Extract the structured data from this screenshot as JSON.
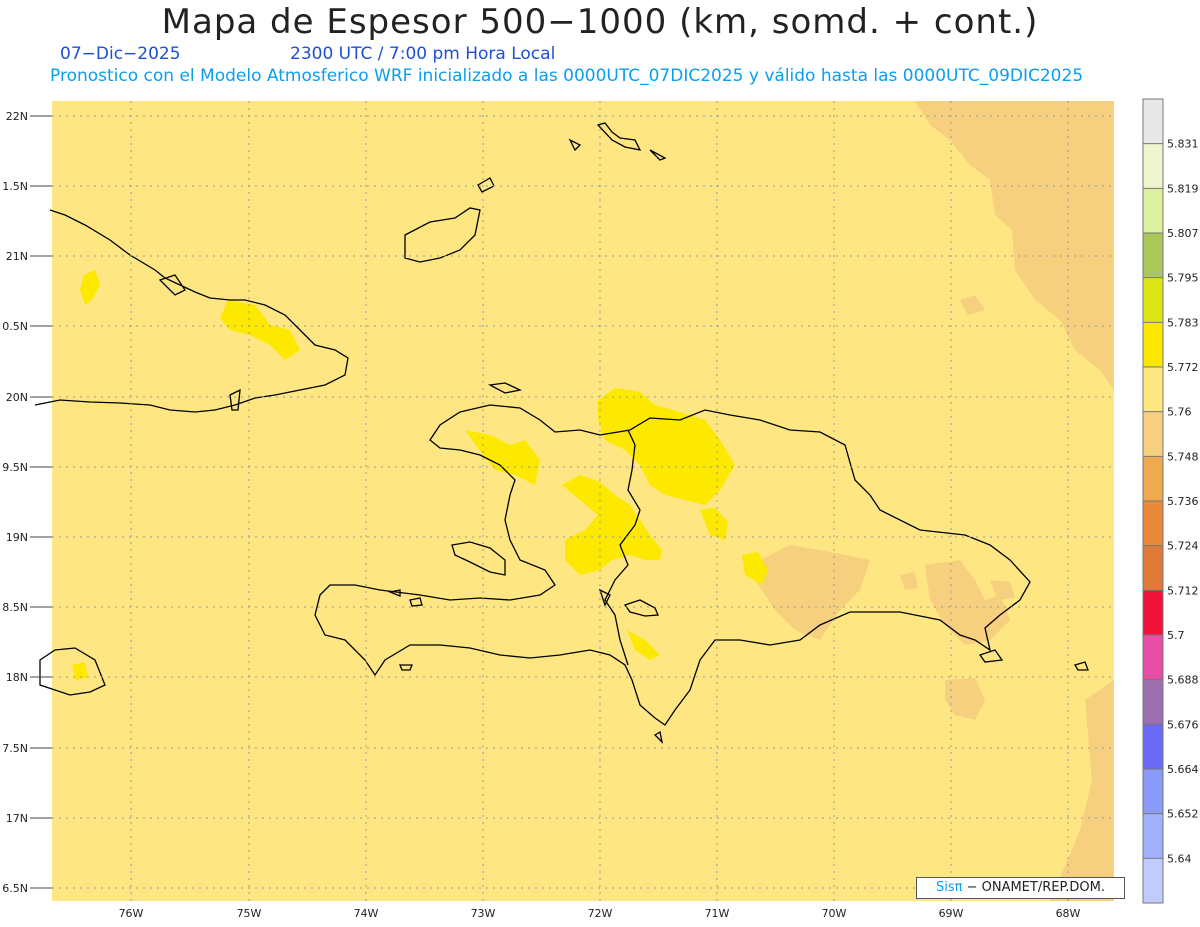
{
  "header": {
    "title": "Mapa de Espesor 500−1000 (km, somd. + cont.)",
    "date": "07−Dic−2025",
    "time": "2300 UTC / 7:00 pm Hora Local",
    "model": "Pronostico con el Modelo Atmosferico WRF inicializado a las 0000UTC_07DIC2025 y válido hasta las  0000UTC_09DIC2025"
  },
  "map": {
    "lat_labels": [
      "22N",
      "1.5N",
      "21N",
      "0.5N",
      "20N",
      "9.5N",
      "19N",
      "8.5N",
      "18N",
      "7.5N",
      "17N",
      "6.5N"
    ],
    "lon_labels": [
      "76W",
      "75W",
      "74W",
      "73W",
      "72W",
      "71W",
      "70W",
      "69W",
      "68W"
    ],
    "colors": {
      "background": "#fee783",
      "dark": "#f6cf7f",
      "bright": "#fde800",
      "coast": "#000000"
    }
  },
  "colorbar": {
    "labels": [
      "5.831",
      "5.819",
      "5.807",
      "5.795",
      "5.783",
      "5.772",
      "5.76",
      "5.748",
      "5.736",
      "5.724",
      "5.712",
      "5.7",
      "5.688",
      "5.676",
      "5.664",
      "5.652",
      "5.64"
    ],
    "colors": [
      "#e8e8e8",
      "#f0f5d0",
      "#dcf0a0",
      "#a8c85a",
      "#dce614",
      "#fae600",
      "#fee783",
      "#f6cf7f",
      "#efaa50",
      "#e88a3a",
      "#e07a38",
      "#f0103a",
      "#e64fa5",
      "#9c6fb0",
      "#6a6af7",
      "#8a9af9",
      "#a0b0fc",
      "#c0ccfe"
    ]
  },
  "credit": {
    "brand": "Sisπ",
    "text": "− ONAMET/REP.DOM."
  }
}
